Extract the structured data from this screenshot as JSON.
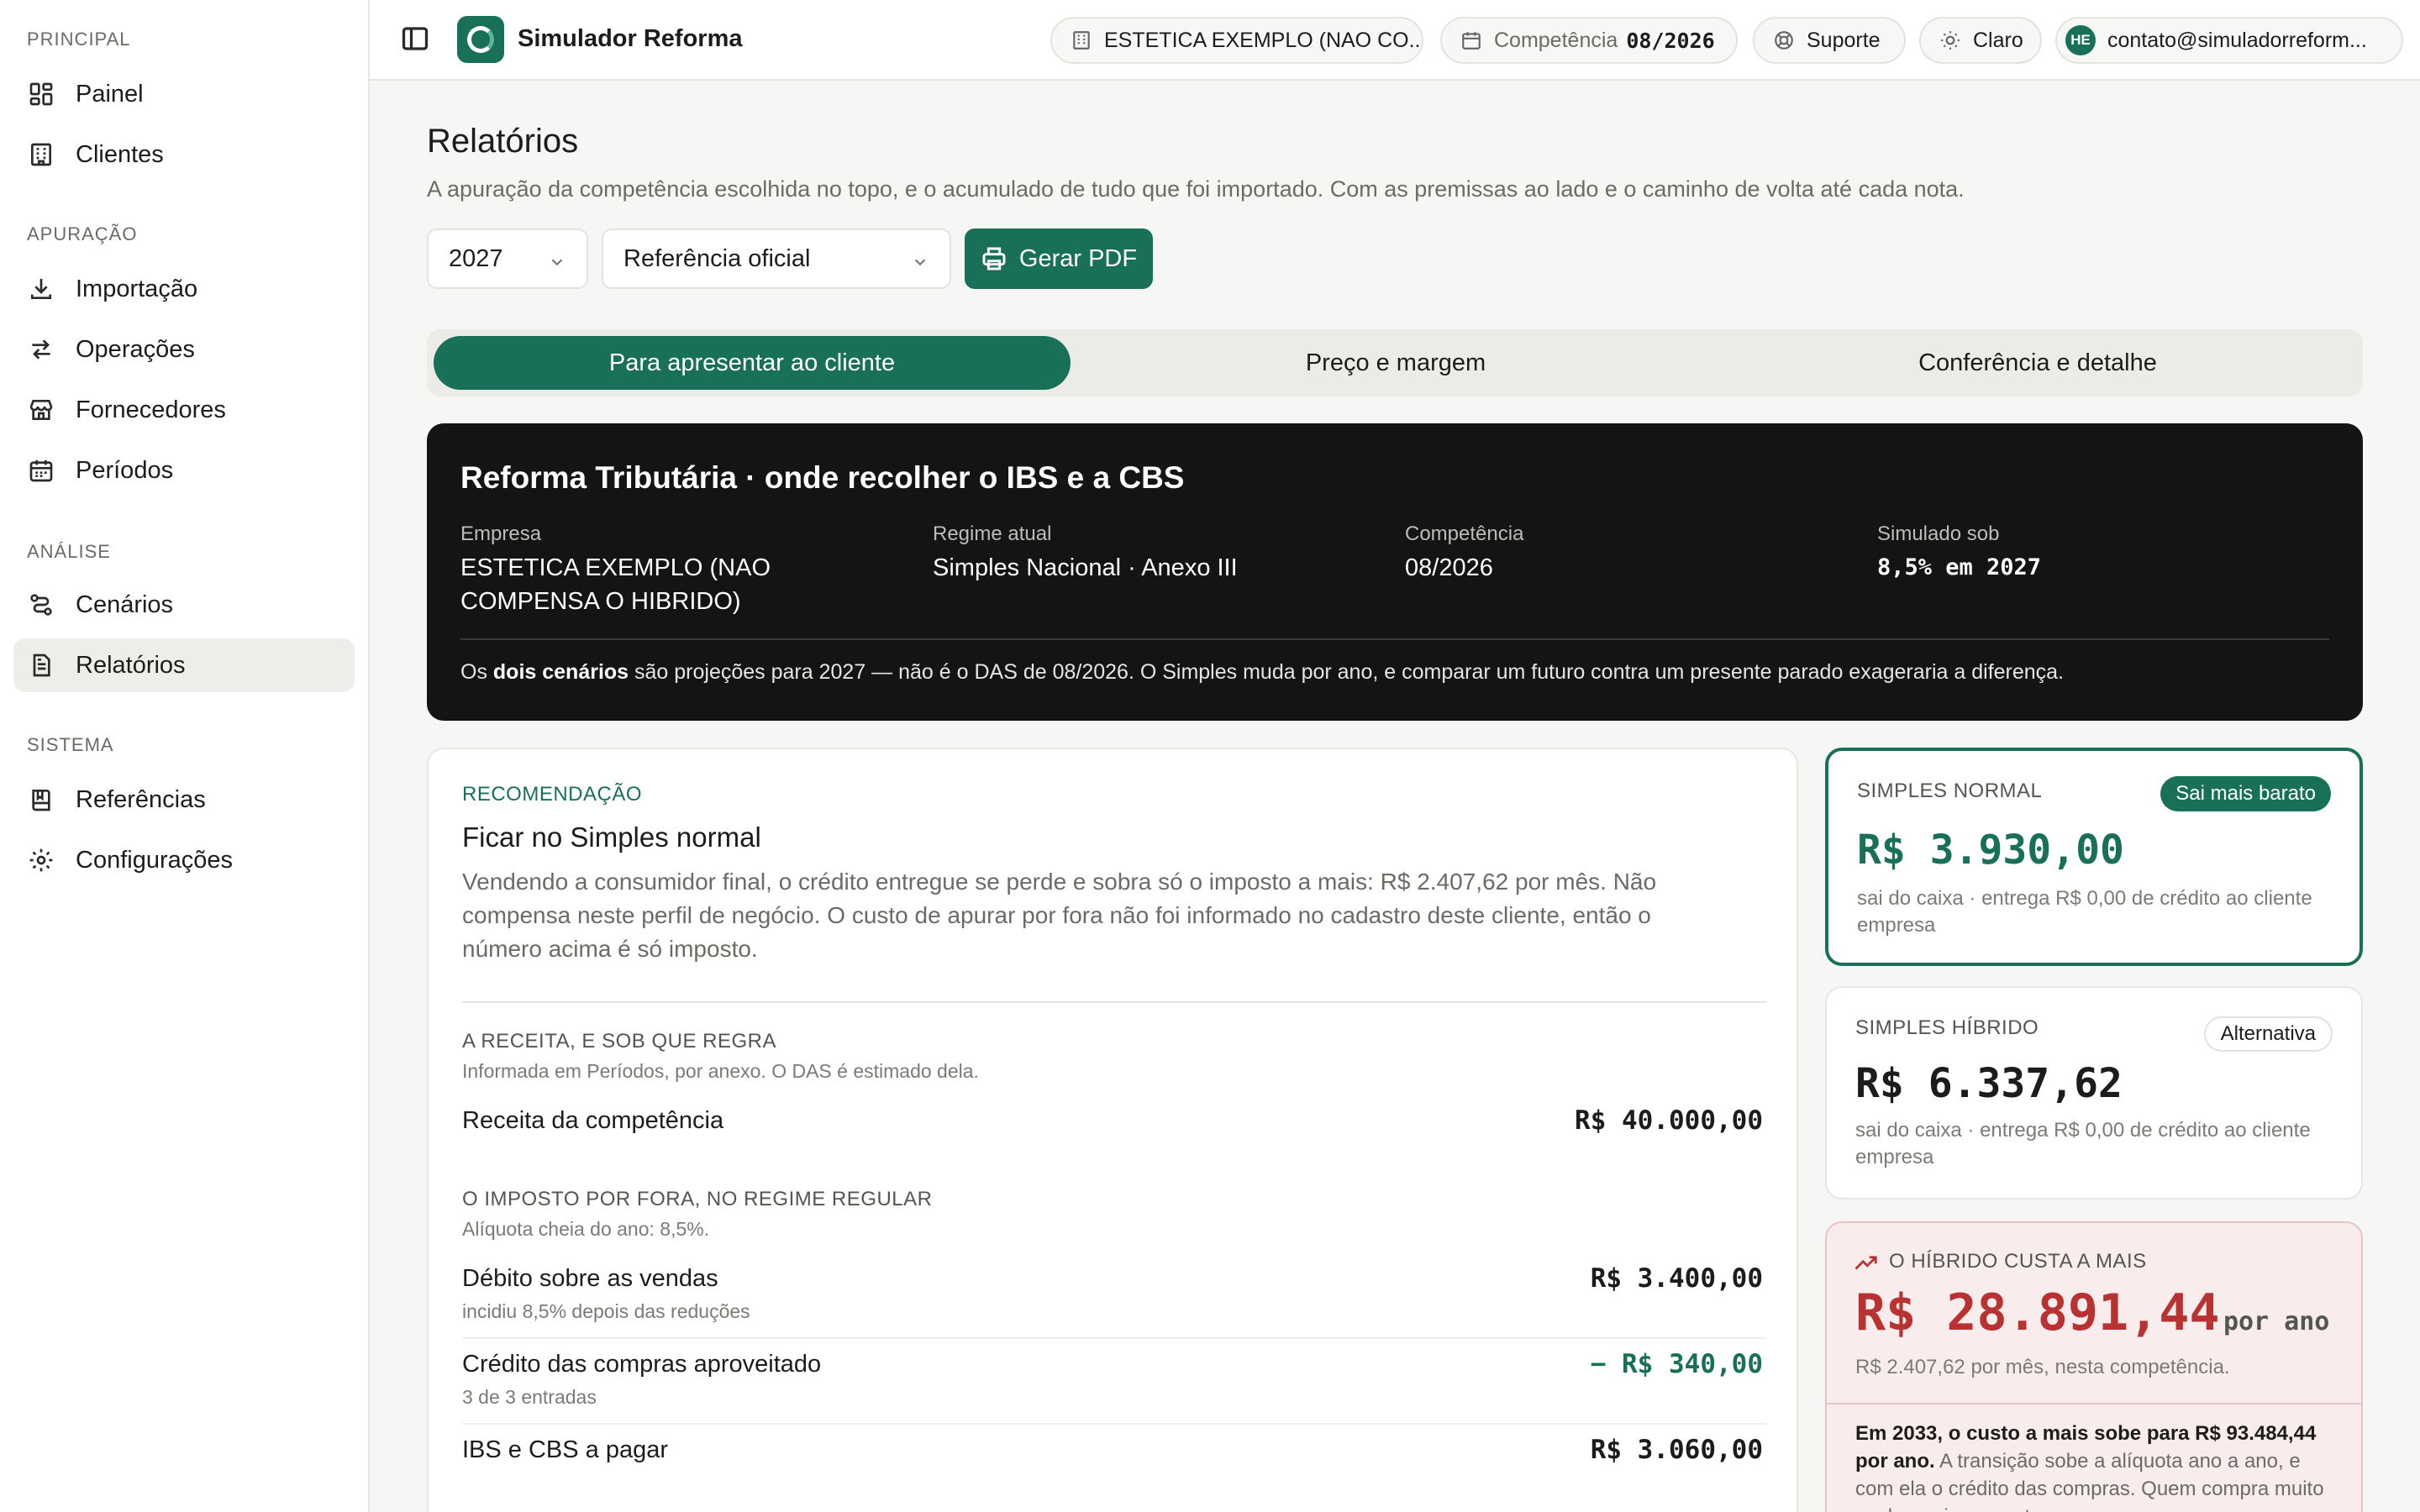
{
  "sidebar": {
    "sections": [
      "PRINCIPAL",
      "APURAÇÃO",
      "ANÁLISE",
      "SISTEMA"
    ],
    "items": [
      {
        "label": "Painel",
        "icon": "dashboard-icon"
      },
      {
        "label": "Clientes",
        "icon": "building-icon"
      },
      {
        "label": "Importação",
        "icon": "download-icon"
      },
      {
        "label": "Operações",
        "icon": "swap-icon"
      },
      {
        "label": "Fornecedores",
        "icon": "store-icon"
      },
      {
        "label": "Períodos",
        "icon": "calendar-icon"
      },
      {
        "label": "Cenários",
        "icon": "route-icon"
      },
      {
        "label": "Relatórios",
        "icon": "document-icon",
        "active": true
      },
      {
        "label": "Referências",
        "icon": "book-icon"
      },
      {
        "label": "Configurações",
        "icon": "gear-icon"
      }
    ]
  },
  "topbar": {
    "app_title": "Simulador Reforma",
    "company": "ESTETICA EXEMPLO (NAO CO...",
    "competencia_label": "Competência",
    "competencia_value": "08/2026",
    "support": "Suporte",
    "theme": "Claro",
    "avatar_initials": "HE",
    "user_email": "contato@simuladorreform..."
  },
  "page": {
    "title": "Relatórios",
    "subtitle": "A apuração da competência escolhida no topo, e o acumulado de tudo que foi importado. Com as premissas ao lado e o caminho de volta até cada nota.",
    "year_select": "2027",
    "reference_select": "Referência oficial",
    "pdf_button": "Gerar PDF"
  },
  "tabs": [
    "Para apresentar ao cliente",
    "Preço e margem",
    "Conferência e detalhe"
  ],
  "hero": {
    "title": "Reforma Tributária · onde recolher o IBS e a CBS",
    "fields": [
      {
        "label": "Empresa",
        "value": "ESTETICA EXEMPLO (NAO COMPENSA O HIBRIDO)"
      },
      {
        "label": "Regime atual",
        "value": "Simples Nacional · Anexo III"
      },
      {
        "label": "Competência",
        "value": "08/2026"
      },
      {
        "label": "Simulado sob",
        "value": "8,5% em 2027"
      }
    ],
    "note_pre": "Os ",
    "note_bold": "dois cenários",
    "note_post": " são projeções para 2027 — não é o DAS de 08/2026. O Simples muda por ano, e comparar um futuro contra um presente parado exageraria a diferença."
  },
  "recommendation": {
    "tag": "RECOMENDAÇÃO",
    "title": "Ficar no Simples normal",
    "text": "Vendendo a consumidor final, o crédito entregue se perde e sobra só o imposto a mais: R$ 2.407,62 por mês. Não compensa neste perfil de negócio. O custo de apurar por fora não foi informado no cadastro deste cliente, então o número acima é só imposto.",
    "group1_label": "A RECEITA, E SOB QUE REGRA",
    "group1_note": "Informada em Períodos, por anexo. O DAS é estimado dela.",
    "revenue_label": "Receita da competência",
    "revenue_value": "R$ 40.000,00",
    "group2_label": "O IMPOSTO POR FORA, NO REGIME REGULAR",
    "group2_note": "Alíquota cheia do ano: 8,5%.",
    "rows": [
      {
        "label": "Débito sobre as vendas",
        "sub": "incidiu 8,5% depois das reduções",
        "value": "R$ 3.400,00"
      },
      {
        "label": "Crédito das compras aproveitado",
        "sub": "3 de 3 entradas",
        "value": "− R$ 340,00"
      },
      {
        "label": "IBS e CBS a pagar",
        "sub": "",
        "value": "R$ 3.060,00"
      }
    ]
  },
  "cards": {
    "normal": {
      "label": "SIMPLES NORMAL",
      "badge": "Sai mais barato",
      "value": "R$ 3.930,00",
      "note": "sai do caixa · entrega R$ 0,00 de crédito ao cliente empresa"
    },
    "hibrido": {
      "label": "SIMPLES HÍBRIDO",
      "badge": "Alternativa",
      "value": "R$ 6.337,62",
      "note": "sai do caixa · entrega R$ 0,00 de crédito ao cliente empresa"
    },
    "extra": {
      "label": "O HÍBRIDO CUSTA A MAIS",
      "value": "R$ 28.891,44",
      "unit": "por ano",
      "note": "R$ 2.407,62 por mês, nesta competência.",
      "bottom_bold": "Em 2033, o custo a mais sobe para R$ 93.484,44 por ano.",
      "bottom_text": " A transição sobe a alíquota ano a ano, e com ela o crédito das compras. Quem compra muito sonha mais com o tempo."
    }
  },
  "colors": {
    "accent": "#187058",
    "alert": "#b83232",
    "hero_bg": "#141414"
  }
}
